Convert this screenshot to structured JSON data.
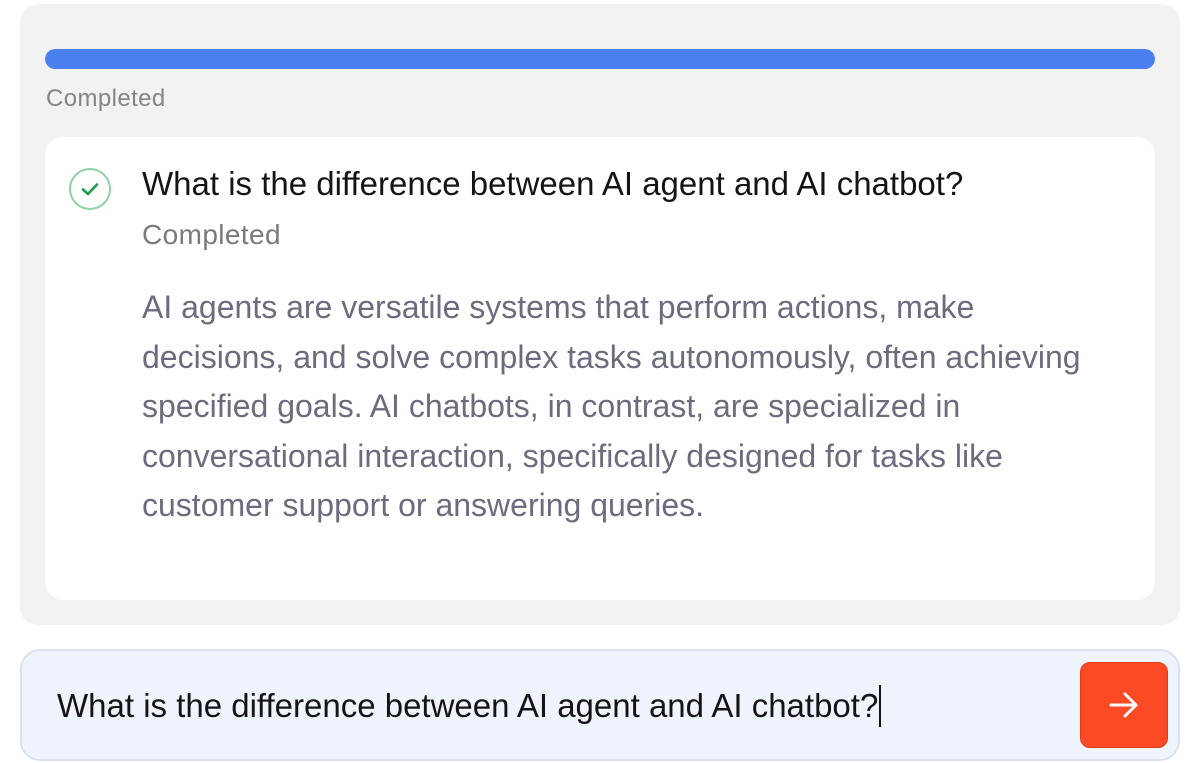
{
  "progress": {
    "value": 1.0,
    "status_label": "Completed",
    "color": "#4a7ff0"
  },
  "task": {
    "icon": "check-circle-icon",
    "title": "What is the difference between AI agent and AI chatbot?",
    "status": "Completed",
    "answer": "AI agents are versatile systems that perform actions, make decisions, and solve complex tasks autonomously, often achieving specified goals. AI chatbots, in contrast, are specialized in conversational interaction, specifically designed for tasks like customer support or answering queries."
  },
  "input": {
    "value": "What is the difference between AI agent and AI chatbot?",
    "send_icon": "arrow-right-icon",
    "send_color": "#fb4a24"
  }
}
